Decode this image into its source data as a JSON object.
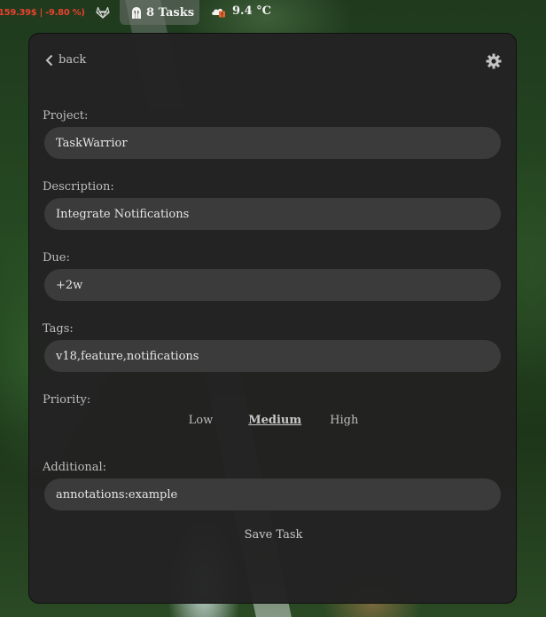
{
  "topbar": {
    "stock_text": "159.39$ | -9.80 %)",
    "tasks_label": "8 Tasks",
    "weather_label": "9.4 °C",
    "icons": {
      "gitlab": "gitlab-icon",
      "tasks": "helmet-icon",
      "weather": "cloud-alert-icon"
    },
    "stock_color": "#e8412e"
  },
  "panel": {
    "back_label": "back",
    "settings_icon": "gear-icon",
    "fields": [
      {
        "label": "Project:",
        "value": "TaskWarrior"
      },
      {
        "label": "Description:",
        "value": "Integrate Notifications"
      },
      {
        "label": "Due:",
        "value": "+2w"
      },
      {
        "label": "Tags:",
        "value": "v18,feature,notifications"
      }
    ],
    "priority": {
      "label": "Priority:",
      "options": [
        "Low",
        "Medium",
        "High"
      ],
      "selected": "Medium"
    },
    "additional": {
      "label": "Additional:",
      "value": "annotations:example"
    },
    "save_label": "Save Task"
  }
}
